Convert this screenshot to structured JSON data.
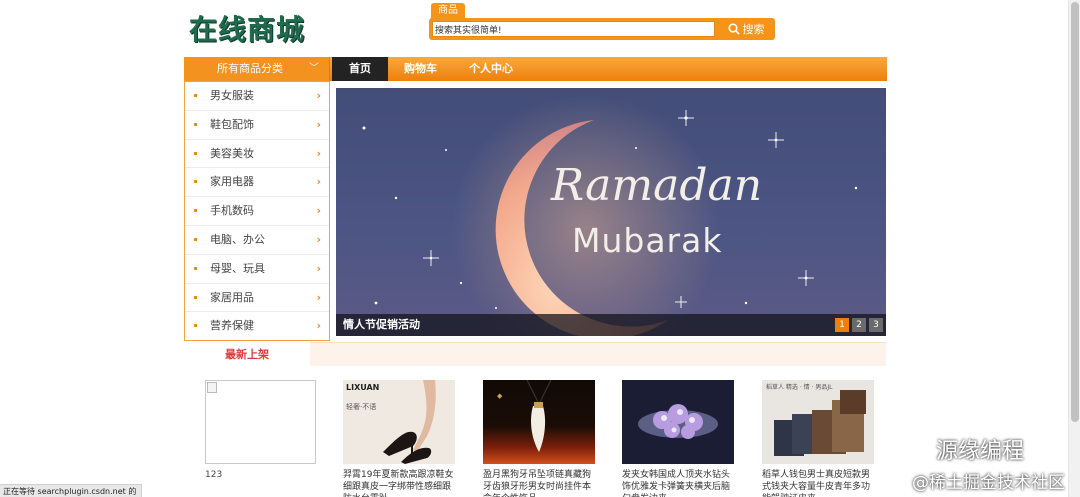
{
  "header": {
    "logo_text": "在线商城",
    "search_tab": "商品",
    "search_placeholder": "搜索其实很简单!",
    "search_button": "搜索"
  },
  "nav": {
    "all_categories": "所有商品分类",
    "items": [
      "首页",
      "购物车",
      "个人中心"
    ]
  },
  "sidebar": {
    "categories": [
      "男女服装",
      "鞋包配饰",
      "美容美妆",
      "家用电器",
      "手机数码",
      "电脑、办公",
      "母婴、玩具",
      "家居用品",
      "营养保健"
    ]
  },
  "banner": {
    "title_line1": "Ramadan",
    "title_line2": "Mubarak",
    "caption": "情人节促销活动",
    "pages": [
      "1",
      "2",
      "3"
    ],
    "active_page": "1"
  },
  "new_arrivals": {
    "tab": "最新上架",
    "products": [
      {
        "title": "123"
      },
      {
        "title": "羿霄19年夏新款高跟凉鞋女细跟真皮一字绑带性感细跟防水台露趾",
        "brand": "LIXUAN",
        "tagline": "轻奢·不语",
        "colors": [
          "#efe9e2",
          "#3a2c28"
        ]
      },
      {
        "title": "盈月黑狗牙吊坠项链真藏狗牙齿狼牙形男女时尚挂件本命年个性饰品",
        "colors": [
          "#1a0d06",
          "#c6401a"
        ]
      },
      {
        "title": "发夹女韩国成人顶夹水钻头饰优雅发卡弹簧夹横夹后脑勺盘发边夹",
        "colors": [
          "#2a2f4e",
          "#b79ce0"
        ]
      },
      {
        "title": "稻草人钱包男士真皮短款男式钱夹大容量牛皮青年多功能驾驶证皮夹",
        "brand": "稻草人 精选 · 情 · 男品JL",
        "colors": [
          "#e9e6e2",
          "#6b4a35"
        ]
      }
    ]
  },
  "status_bar": "正在等待 searchplugin.csdn.net 的响应...",
  "watermarks": {
    "wechat": "源缘编程",
    "juejin": "@稀土掘金技术社区"
  },
  "colors": {
    "accent": "#f59418",
    "nav_dark": "#232323",
    "logo": "#1f6b4e",
    "new_tab": "#e4393c"
  }
}
